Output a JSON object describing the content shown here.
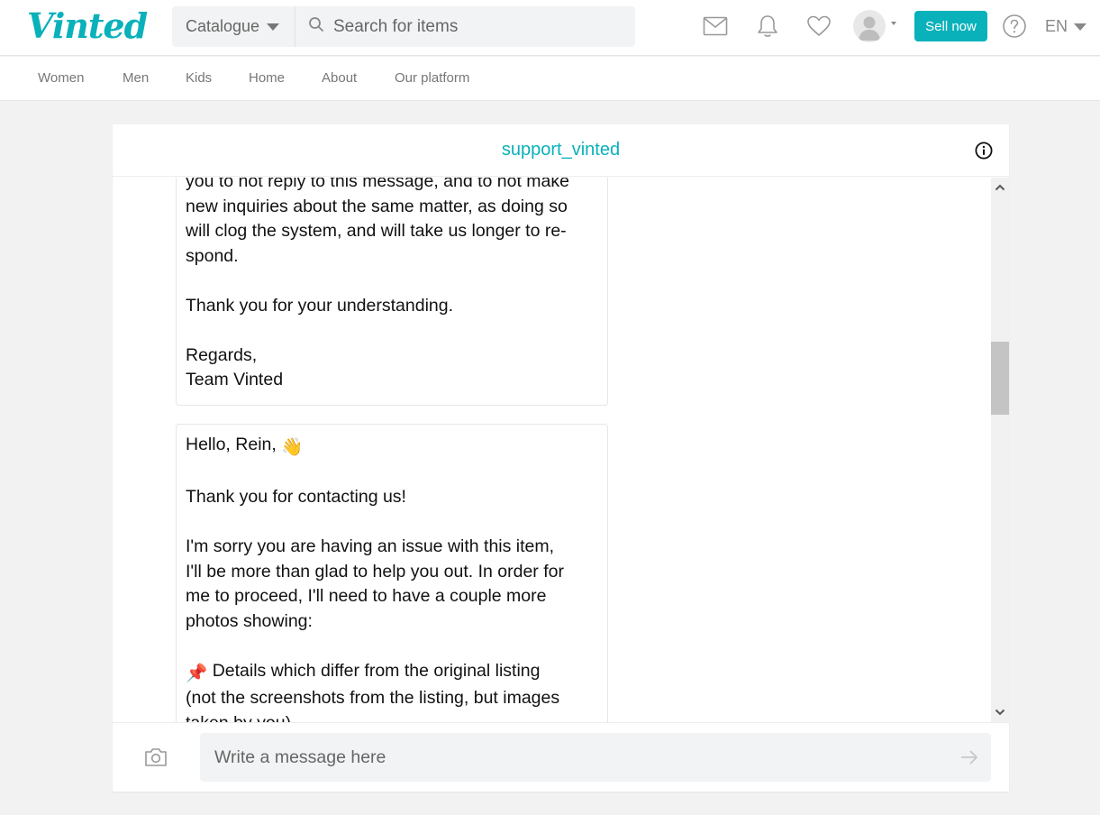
{
  "header": {
    "logo": "Vinted",
    "catalogue_label": "Catalogue",
    "search_placeholder": "Search for items",
    "icons": [
      "mail-icon",
      "bell-icon",
      "heart-icon",
      "avatar",
      "help-icon"
    ],
    "sell_label": "Sell now",
    "language": "EN"
  },
  "nav": {
    "items": [
      "Women",
      "Men",
      "Kids",
      "Home",
      "About",
      "Our platform"
    ]
  },
  "chat": {
    "title": "support_vinted",
    "messages": [
      {
        "text": "you to not reply to this message, and to not make\nnew inquiries about the same matter, as doing so\nwill clog the system, and will take us longer to re-\nspond.\n\nThank you for your understanding.\n\nRegards,\nTeam Vinted"
      },
      {
        "greeting": "Hello, Rein,",
        "greeting_emoji": "👋",
        "body": "\n\nThank you for contacting us!\n\nI'm sorry you are having an issue with this item,\nI'll be more than glad to help you out. In order for\nme to proceed, I'll need to have a couple more\nphotos showing:\n\n",
        "bullet_emoji": "📌",
        "bullet_text": " Details which differ from the original listing\n(not the screenshots from the listing, but images\ntaken by you)"
      }
    ],
    "composer_placeholder": "Write a message here"
  },
  "colors": {
    "brand": "#09b1ba",
    "background": "#f2f2f2",
    "input_bg": "#f1f3f4"
  }
}
